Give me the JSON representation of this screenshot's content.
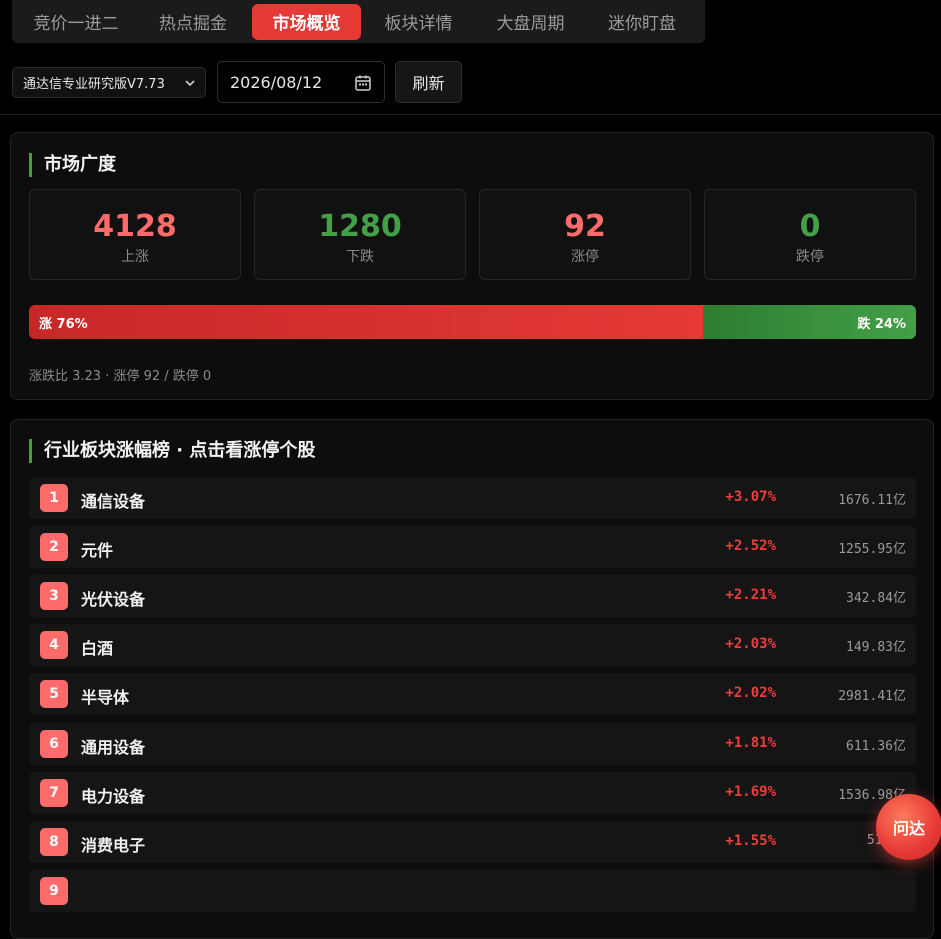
{
  "tabs": [
    {
      "label": "竞价一进二"
    },
    {
      "label": "热点掘金"
    },
    {
      "label": "市场概览",
      "active": true
    },
    {
      "label": "板块详情"
    },
    {
      "label": "大盘周期"
    },
    {
      "label": "迷你盯盘"
    }
  ],
  "toolbar": {
    "source_value": "通达信专业研究版V7.73",
    "date_value": "2026/08/12",
    "refresh_label": "刷新"
  },
  "breadth": {
    "title": "市场广度",
    "stats": [
      {
        "value": "4128",
        "label": "上涨",
        "color": "#ff6b6b"
      },
      {
        "value": "1280",
        "label": "下跌",
        "color": "#43a047"
      },
      {
        "value": "92",
        "label": "涨停",
        "color": "#ff6b6b"
      },
      {
        "value": "0",
        "label": "跌停",
        "color": "#43a047"
      }
    ],
    "up_percent": 76,
    "up_label": "涨 76%",
    "down_label": "跌 24%",
    "summary": "涨跌比 3.23 · 涨停 92 / 跌停 0"
  },
  "sectors": {
    "title": "行业板块涨幅榜 · 点击看涨停个股",
    "rows": [
      {
        "rank": "1",
        "name": "通信设备",
        "change": "+3.07%",
        "amount": "1676.11亿"
      },
      {
        "rank": "2",
        "name": "元件",
        "change": "+2.52%",
        "amount": "1255.95亿"
      },
      {
        "rank": "3",
        "name": "光伏设备",
        "change": "+2.21%",
        "amount": "342.84亿"
      },
      {
        "rank": "4",
        "name": "白酒",
        "change": "+2.03%",
        "amount": "149.83亿"
      },
      {
        "rank": "5",
        "name": "半导体",
        "change": "+2.02%",
        "amount": "2981.41亿"
      },
      {
        "rank": "6",
        "name": "通用设备",
        "change": "+1.81%",
        "amount": "611.36亿"
      },
      {
        "rank": "7",
        "name": "电力设备",
        "change": "+1.69%",
        "amount": "1536.98亿"
      },
      {
        "rank": "8",
        "name": "消费电子",
        "change": "+1.55%",
        "amount": "513.1"
      },
      {
        "rank": "9",
        "name": "",
        "change": "",
        "amount": ""
      }
    ]
  },
  "fab": {
    "label": "问达"
  },
  "colors": {
    "accent": "#e53935",
    "up": "#ff6b6b",
    "down": "#43a047"
  }
}
